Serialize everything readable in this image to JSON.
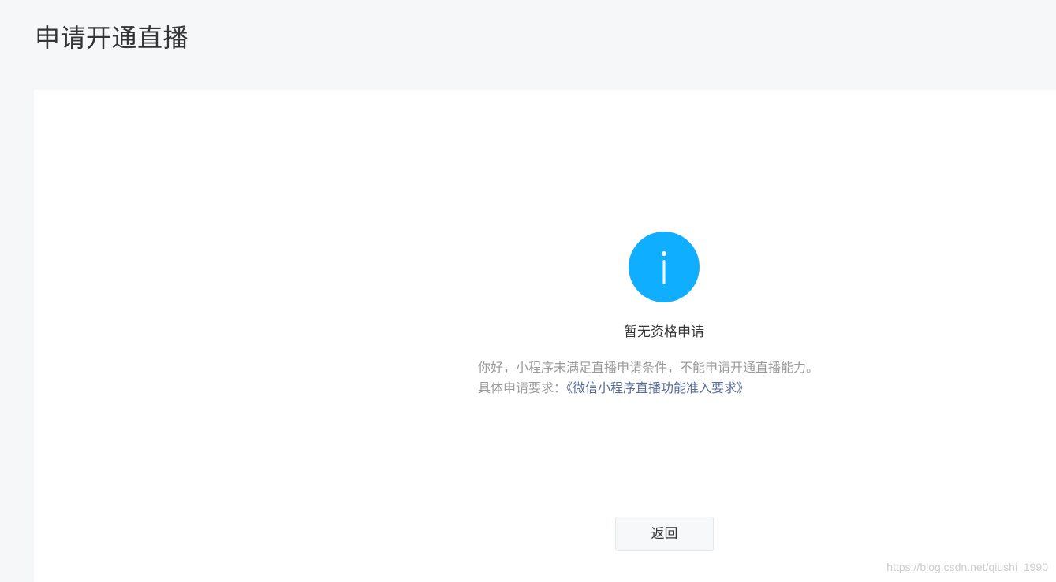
{
  "page": {
    "title": "申请开通直播"
  },
  "status": {
    "icon": "info-icon",
    "title": "暂无资格申请",
    "description_line1": "你好，小程序未满足直播申请条件，不能申请开通直播能力。",
    "description_line2_prefix": "具体申请要求：",
    "requirements_link": "《微信小程序直播功能准入要求》"
  },
  "actions": {
    "back_label": "返回"
  },
  "watermark": {
    "text": "https://blog.csdn.net/qiushi_1990"
  },
  "colors": {
    "background": "#f6f7f9",
    "card": "#ffffff",
    "icon": "#10aeff",
    "link": "#576b95",
    "muted_text": "#9a9a9a",
    "text": "#353535"
  }
}
